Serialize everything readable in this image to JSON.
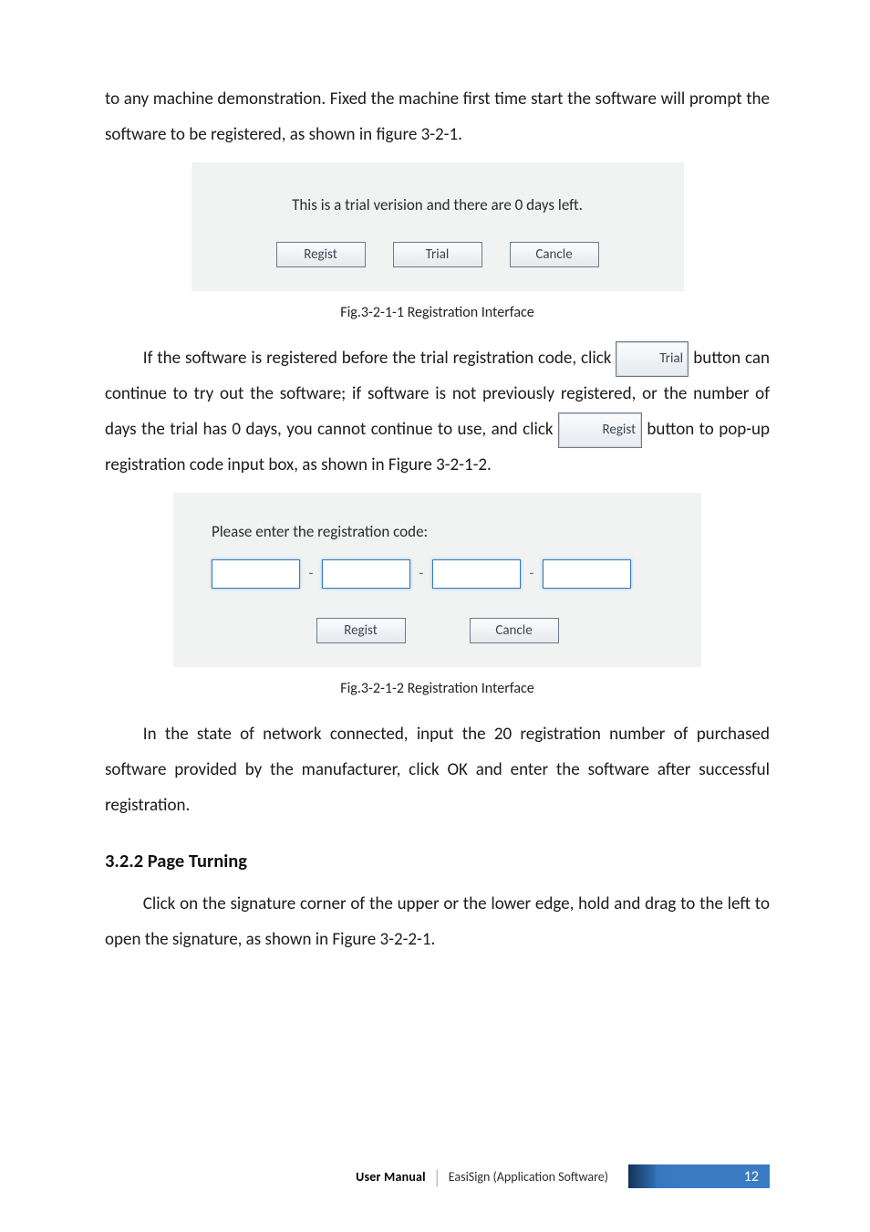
{
  "intro_para": "to any machine demonstration. Fixed the machine first time start the software will prompt the software to be registered, as shown in figure 3-2-1.",
  "dialog1": {
    "message": "This is a trial verision and there are 0 days left.",
    "buttons": {
      "regist": "Regist",
      "trial": "Trial",
      "cancle": "Cancle"
    }
  },
  "caption1": "Fig.3-2-1-1 Registration Interface",
  "mid_text": {
    "seg1": "If the software is registered before the trial registration code, click ",
    "trial_btn": "Trial",
    "seg2": " button can continue to try out the software; if software is not previously registered, or the number of days the trial has 0 days, you cannot continue to use, and click ",
    "regist_btn": "Regist",
    "seg3": " button to pop-up registration code input box, as shown in Figure 3-2-1-2."
  },
  "dialog2": {
    "prompt": "Please enter the registration code:",
    "buttons": {
      "regist": "Regist",
      "cancle": "Cancle"
    }
  },
  "caption2": "Fig.3-2-1-2 Registration Interface",
  "after_dialog2": "In the state of network connected, input the 20 registration number of purchased software provided by the manufacturer, click OK and enter the software after successful registration.",
  "section_heading": "3.2.2 Page Turning",
  "section_body": "Click on the signature corner of the upper or the lower edge, hold and drag to the left to open the signature, as shown in Figure 3-2-2-1.",
  "footer": {
    "user_manual": "User Manual",
    "product": "EasiSign (Application Software)",
    "page": "12"
  }
}
